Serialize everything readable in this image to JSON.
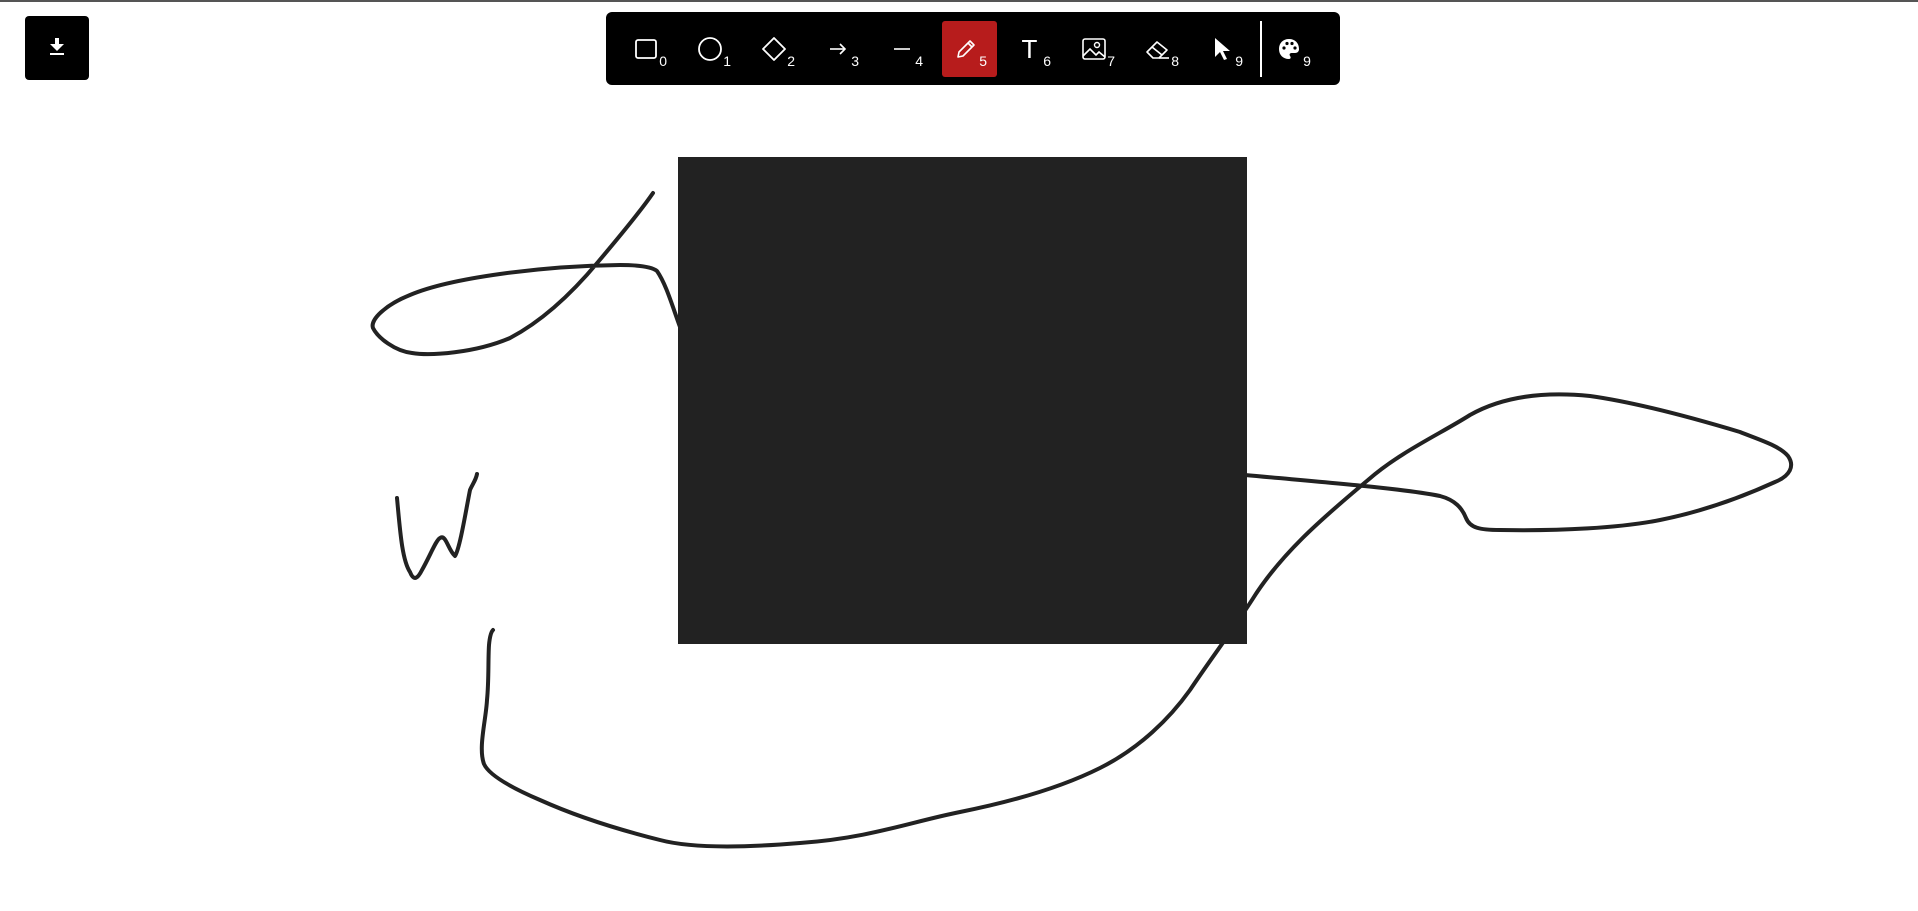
{
  "download": {
    "icon": "download-icon"
  },
  "toolbar": {
    "active_tool": "pencil",
    "tools": [
      {
        "name": "rectangle",
        "icon": "rectangle-icon",
        "shortcut": "0"
      },
      {
        "name": "ellipse",
        "icon": "ellipse-icon",
        "shortcut": "1"
      },
      {
        "name": "diamond",
        "icon": "diamond-icon",
        "shortcut": "2"
      },
      {
        "name": "arrow",
        "icon": "arrow-icon",
        "shortcut": "3"
      },
      {
        "name": "line",
        "icon": "line-icon",
        "shortcut": "4"
      },
      {
        "name": "pencil",
        "icon": "pencil-icon",
        "shortcut": "5"
      },
      {
        "name": "text",
        "icon": "text-icon",
        "glyph": "T",
        "shortcut": "6"
      },
      {
        "name": "image",
        "icon": "image-icon",
        "shortcut": "7"
      },
      {
        "name": "eraser",
        "icon": "eraser-icon",
        "shortcut": "8"
      },
      {
        "name": "select",
        "icon": "cursor-icon",
        "shortcut": "9"
      },
      {
        "name": "color-palette",
        "icon": "palette-icon",
        "shortcut": "9"
      }
    ]
  },
  "colors": {
    "toolbar_bg": "#000000",
    "active_tool_bg": "#b71c1c",
    "stroke": "#222222",
    "fill": "#222222",
    "canvas_bg": "#ffffff"
  }
}
